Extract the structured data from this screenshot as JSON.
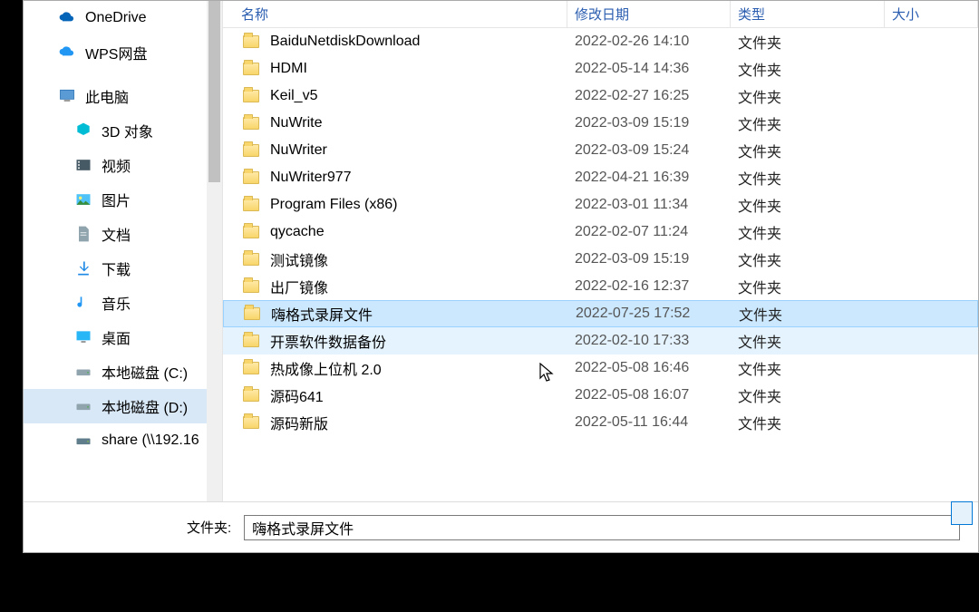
{
  "sidebar": {
    "items": [
      {
        "label": "OneDrive",
        "icon": "cloud-onedrive"
      },
      {
        "label": "WPS网盘",
        "icon": "cloud-wps"
      },
      {
        "label": "此电脑",
        "icon": "computer"
      },
      {
        "label": "3D 对象",
        "icon": "3d",
        "indent": true
      },
      {
        "label": "视频",
        "icon": "video",
        "indent": true
      },
      {
        "label": "图片",
        "icon": "pictures",
        "indent": true
      },
      {
        "label": "文档",
        "icon": "documents",
        "indent": true
      },
      {
        "label": "下载",
        "icon": "downloads",
        "indent": true
      },
      {
        "label": "音乐",
        "icon": "music",
        "indent": true
      },
      {
        "label": "桌面",
        "icon": "desktop",
        "indent": true
      },
      {
        "label": "本地磁盘 (C:)",
        "icon": "drive",
        "indent": true
      },
      {
        "label": "本地磁盘 (D:)",
        "icon": "drive",
        "indent": true,
        "selected": true
      },
      {
        "label": "share (\\\\192.16",
        "icon": "netdrive",
        "indent": true
      }
    ]
  },
  "columns": {
    "name": "名称",
    "date": "修改日期",
    "type": "类型",
    "size": "大小"
  },
  "files": [
    {
      "name": "BaiduNetdiskDownload",
      "date": "2022-02-26 14:10",
      "type": "文件夹"
    },
    {
      "name": "HDMI",
      "date": "2022-05-14 14:36",
      "type": "文件夹"
    },
    {
      "name": "Keil_v5",
      "date": "2022-02-27 16:25",
      "type": "文件夹"
    },
    {
      "name": "NuWrite",
      "date": "2022-03-09 15:19",
      "type": "文件夹"
    },
    {
      "name": "NuWriter",
      "date": "2022-03-09 15:24",
      "type": "文件夹"
    },
    {
      "name": "NuWriter977",
      "date": "2022-04-21 16:39",
      "type": "文件夹"
    },
    {
      "name": "Program Files (x86)",
      "date": "2022-03-01 11:34",
      "type": "文件夹"
    },
    {
      "name": "qycache",
      "date": "2022-02-07 11:24",
      "type": "文件夹"
    },
    {
      "name": "测试镜像",
      "date": "2022-03-09 15:19",
      "type": "文件夹"
    },
    {
      "name": "出厂镜像",
      "date": "2022-02-16 12:37",
      "type": "文件夹"
    },
    {
      "name": "嗨格式录屏文件",
      "date": "2022-07-25 17:52",
      "type": "文件夹",
      "selected": true
    },
    {
      "name": "开票软件数据备份",
      "date": "2022-02-10 17:33",
      "type": "文件夹",
      "hover": true
    },
    {
      "name": "热成像上位机 2.0",
      "date": "2022-05-08 16:46",
      "type": "文件夹"
    },
    {
      "name": "源码641",
      "date": "2022-05-08 16:07",
      "type": "文件夹"
    },
    {
      "name": "源码新版",
      "date": "2022-05-11 16:44",
      "type": "文件夹"
    }
  ],
  "footer": {
    "label": "文件夹:",
    "value": "嗨格式录屏文件"
  }
}
